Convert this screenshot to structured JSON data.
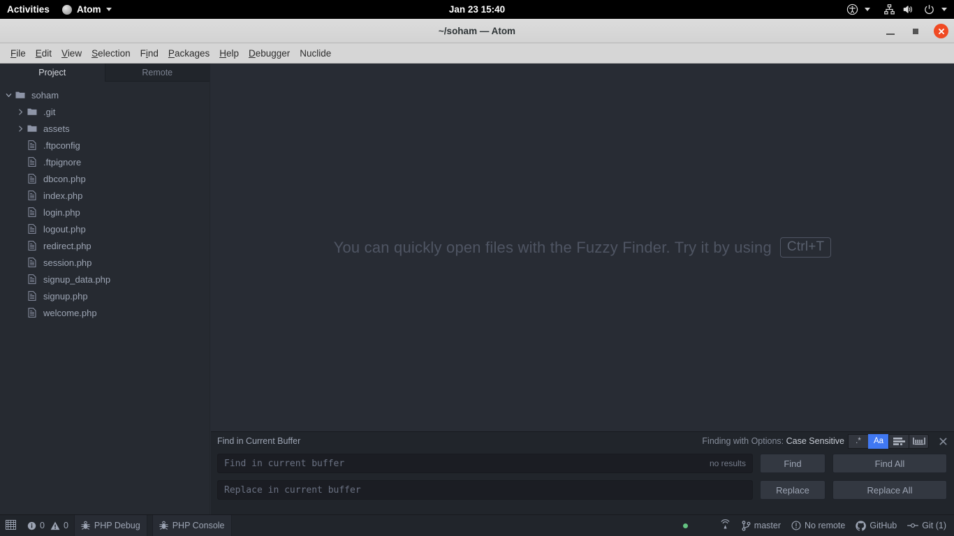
{
  "gnome": {
    "activities": "Activities",
    "app_name": "Atom",
    "clock": "Jan 23 15:40",
    "tray_icons": [
      "accessibility-icon",
      "network-icon",
      "volume-icon",
      "power-icon"
    ]
  },
  "window": {
    "title": "~/soham — Atom",
    "controls": [
      "minimize-button",
      "maximize-button",
      "close-button"
    ],
    "close_color": "#f04a23"
  },
  "menubar": {
    "items": [
      {
        "label": "File",
        "mnemonic": "F"
      },
      {
        "label": "Edit",
        "mnemonic": "E"
      },
      {
        "label": "View",
        "mnemonic": "V"
      },
      {
        "label": "Selection",
        "mnemonic": "S"
      },
      {
        "label": "Find",
        "mnemonic": "i"
      },
      {
        "label": "Packages",
        "mnemonic": "P"
      },
      {
        "label": "Help",
        "mnemonic": "H"
      },
      {
        "label": "Debugger",
        "mnemonic": "D"
      },
      {
        "label": "Nuclide",
        "mnemonic": ""
      }
    ]
  },
  "sidebar": {
    "tabs": [
      {
        "label": "Project",
        "active": true
      },
      {
        "label": "Remote",
        "active": false
      }
    ],
    "tree": [
      {
        "label": "soham",
        "type": "folder",
        "depth": 0,
        "expanded": true
      },
      {
        "label": ".git",
        "type": "folder",
        "depth": 1,
        "expanded": false
      },
      {
        "label": "assets",
        "type": "folder",
        "depth": 1,
        "expanded": false
      },
      {
        "label": ".ftpconfig",
        "type": "file",
        "depth": 1
      },
      {
        "label": ".ftpignore",
        "type": "file",
        "depth": 1
      },
      {
        "label": "dbcon.php",
        "type": "file",
        "depth": 1
      },
      {
        "label": "index.php",
        "type": "file",
        "depth": 1
      },
      {
        "label": "login.php",
        "type": "file",
        "depth": 1
      },
      {
        "label": "logout.php",
        "type": "file",
        "depth": 1
      },
      {
        "label": "redirect.php",
        "type": "file",
        "depth": 1
      },
      {
        "label": "session.php",
        "type": "file",
        "depth": 1
      },
      {
        "label": "signup_data.php",
        "type": "file",
        "depth": 1
      },
      {
        "label": "signup.php",
        "type": "file",
        "depth": 1
      },
      {
        "label": "welcome.php",
        "type": "file",
        "depth": 1
      }
    ]
  },
  "editor": {
    "placeholder_text": "You can quickly open files with the Fuzzy Finder. Try it by using",
    "placeholder_key": "Ctrl+T"
  },
  "find_panel": {
    "title": "Find in Current Buffer",
    "options_prefix": "Finding with Options:",
    "options_value": "Case Sensitive",
    "option_buttons": [
      {
        "name": "regex-toggle",
        "label": ".*",
        "active": false
      },
      {
        "name": "case-sensitive-toggle",
        "label": "Aa",
        "active": true
      },
      {
        "name": "selection-only-toggle",
        "label": "",
        "active": false
      },
      {
        "name": "whole-word-toggle",
        "label": "",
        "active": false
      }
    ],
    "close_label": "×",
    "find_placeholder": "Find in current buffer",
    "find_value": "",
    "result_count": "no results",
    "replace_placeholder": "Replace in current buffer",
    "replace_value": "",
    "buttons": {
      "find": "Find",
      "find_all": "Find All",
      "replace": "Replace",
      "replace_all": "Replace All"
    },
    "accent_color": "#4078f2"
  },
  "statusbar": {
    "info_count": "0",
    "warning_count": "0",
    "php_debug": "PHP Debug",
    "php_console": "PHP Console",
    "branch": "master",
    "remote": "No remote",
    "github": "GitHub",
    "git_changes": "Git (1)",
    "status_dot_color": "#63c381"
  }
}
